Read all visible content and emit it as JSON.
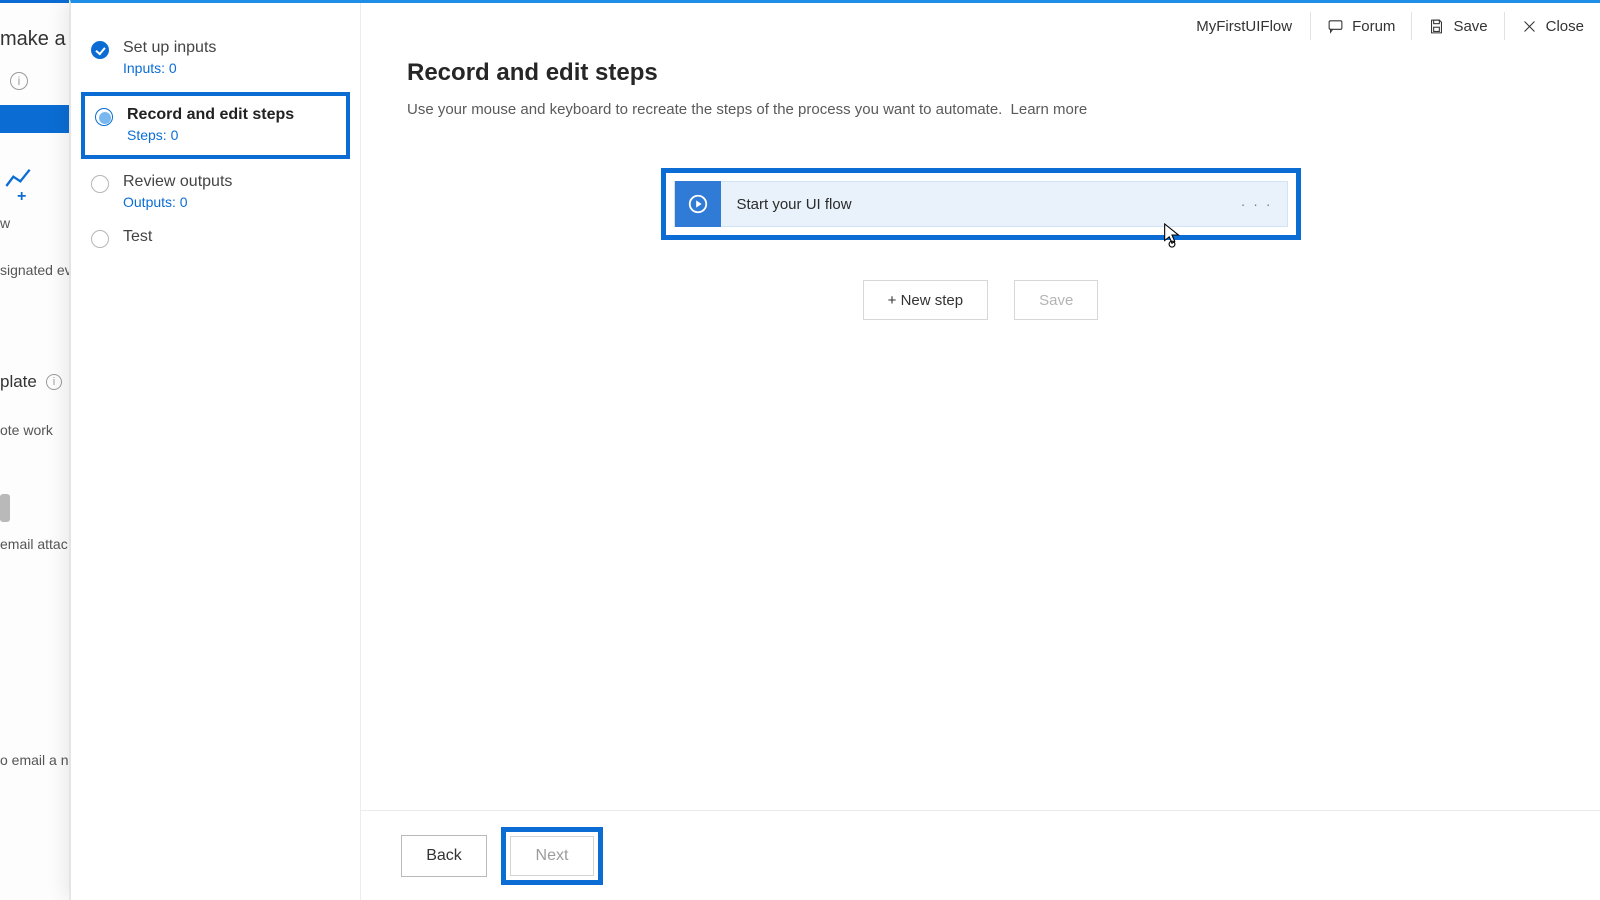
{
  "background": {
    "frag_title": "make a flo",
    "frag_event": "signated even",
    "frag_template": "plate",
    "frag_remote": "ote work",
    "frag_attach": "email attac",
    "frag_email": "o email a ne",
    "frag_w": "w"
  },
  "header": {
    "flow_name": "MyFirstUIFlow",
    "forum": "Forum",
    "save": "Save",
    "close": "Close"
  },
  "wizard": [
    {
      "title": "Set up inputs",
      "sub": "Inputs: 0",
      "state": "completed"
    },
    {
      "title": "Record and edit steps",
      "sub": "Steps: 0",
      "state": "active"
    },
    {
      "title": "Review outputs",
      "sub": "Outputs: 0",
      "state": "pending"
    },
    {
      "title": "Test",
      "sub": "",
      "state": "plain"
    }
  ],
  "main": {
    "heading": "Record and edit steps",
    "description": "Use your mouse and keyboard to recreate the steps of the process you want to automate.",
    "learn_more": "Learn more",
    "card_label": "Start your UI flow",
    "new_step": "+ New step",
    "save_btn": "Save"
  },
  "footer": {
    "back": "Back",
    "next": "Next"
  }
}
